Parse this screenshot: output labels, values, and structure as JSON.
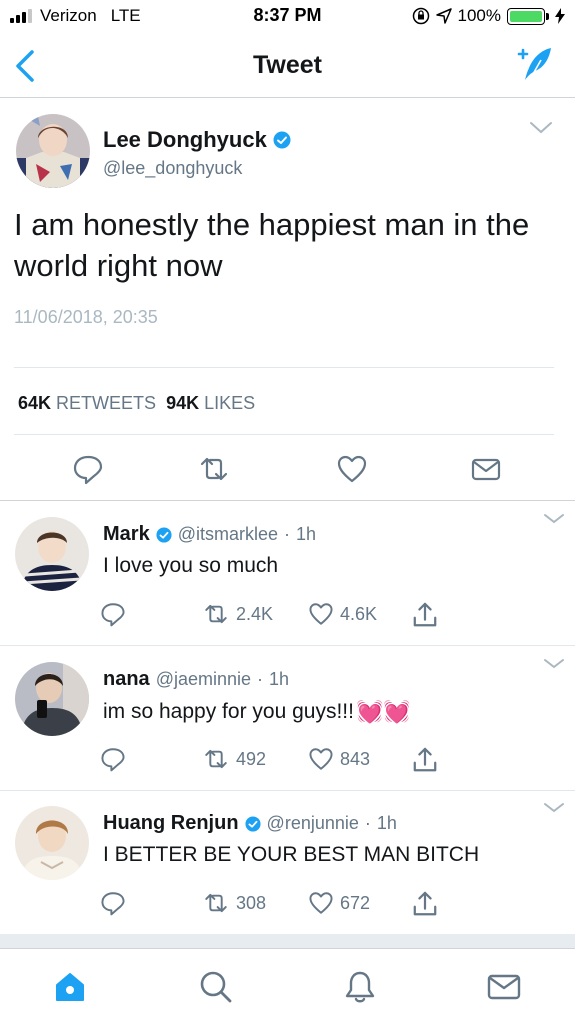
{
  "status_bar": {
    "carrier": "Verizon",
    "network": "LTE",
    "time": "8:37 PM",
    "battery": "100%",
    "battery_level": 1.0,
    "icons": [
      "signal-icon",
      "orientation-lock-icon",
      "location-arrow-icon",
      "battery-icon",
      "charging-bolt-icon"
    ]
  },
  "nav": {
    "title": "Tweet",
    "back_icon": "chevron-left-icon",
    "compose_icon": "compose-tweet-icon"
  },
  "main_tweet": {
    "author_name": "Lee Donghyuck",
    "verified": true,
    "handle": "@lee_donghyuck",
    "text": "I am honestly the happiest man in the world right now",
    "timestamp": "11/06/2018, 20:35",
    "retweets_count": "64K",
    "retweets_label": "RETWEETS",
    "likes_count": "94K",
    "likes_label": "LIKES",
    "actions": [
      "reply-icon",
      "retweet-icon",
      "like-icon",
      "direct-message-icon"
    ]
  },
  "replies": [
    {
      "name": "Mark",
      "verified": true,
      "handle": "@itsmarklee",
      "separator": "·",
      "time": "1h",
      "text": "I love you so much",
      "emoji": "",
      "retweets": "2.4K",
      "likes": "4.6K"
    },
    {
      "name": "nana",
      "verified": false,
      "handle": "@jaeminnie",
      "separator": "·",
      "time": "1h",
      "text": "im so happy for you guys!!!",
      "emoji": "💓💓",
      "retweets": "492",
      "likes": "843"
    },
    {
      "name": "Huang Renjun",
      "verified": true,
      "handle": "@renjunnie",
      "separator": "·",
      "time": "1h",
      "text": "I BETTER BE YOUR BEST MAN BITCH",
      "emoji": "",
      "retweets": "308",
      "likes": "672"
    }
  ],
  "tab_bar": {
    "tabs": [
      "home-icon",
      "search-icon",
      "notifications-icon",
      "messages-icon"
    ],
    "active": "home-icon"
  },
  "colors": {
    "accent": "#1da1f2",
    "text": "#14171a",
    "secondary": "#657786",
    "divider": "#e1e8ed"
  }
}
